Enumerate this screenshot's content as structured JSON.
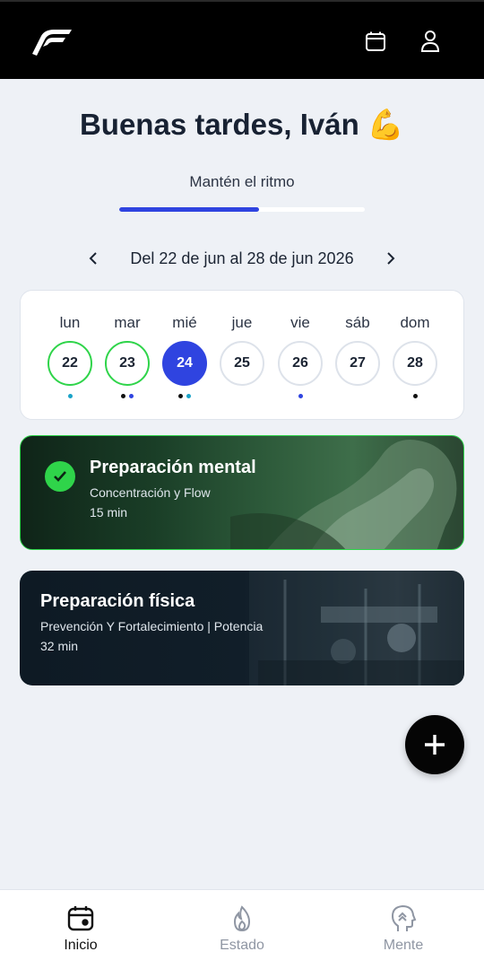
{
  "header": {
    "logo": "brand-logo",
    "icons": [
      "calendar-icon",
      "user-icon"
    ]
  },
  "greeting": "Buenas tardes, Iván 💪",
  "subtitle": "Mantén el ritmo",
  "progress": 0.57,
  "week": {
    "label": "Del 22 de jun al 28 de jun 2026",
    "days": [
      {
        "name": "lun",
        "num": "22",
        "state": "done",
        "dots": [
          "#1aa3c8"
        ]
      },
      {
        "name": "mar",
        "num": "23",
        "state": "done",
        "dots": [
          "#111111",
          "#2f44e0"
        ]
      },
      {
        "name": "mié",
        "num": "24",
        "state": "active",
        "dots": [
          "#111111",
          "#1aa3c8"
        ]
      },
      {
        "name": "jue",
        "num": "25",
        "state": "default",
        "dots": []
      },
      {
        "name": "vie",
        "num": "26",
        "state": "default",
        "dots": [
          "#2f44e0"
        ]
      },
      {
        "name": "sáb",
        "num": "27",
        "state": "default",
        "dots": []
      },
      {
        "name": "dom",
        "num": "28",
        "state": "default",
        "dots": [
          "#111111"
        ]
      }
    ]
  },
  "sessions": [
    {
      "title": "Preparación mental",
      "subtitle": "Concentración y Flow",
      "duration": "15 min",
      "completed": true
    },
    {
      "title": "Preparación física",
      "subtitle": "Prevención Y Fortalecimiento | Potencia",
      "duration": "32 min",
      "completed": false
    }
  ],
  "nav": [
    {
      "label": "Inicio",
      "icon": "calendar-icon",
      "active": true
    },
    {
      "label": "Estado",
      "icon": "flame-icon",
      "active": false
    },
    {
      "label": "Mente",
      "icon": "head-icon",
      "active": false
    }
  ],
  "colors": {
    "accent": "#2f44e0",
    "success": "#2fd44a",
    "background": "#eef1f6"
  }
}
